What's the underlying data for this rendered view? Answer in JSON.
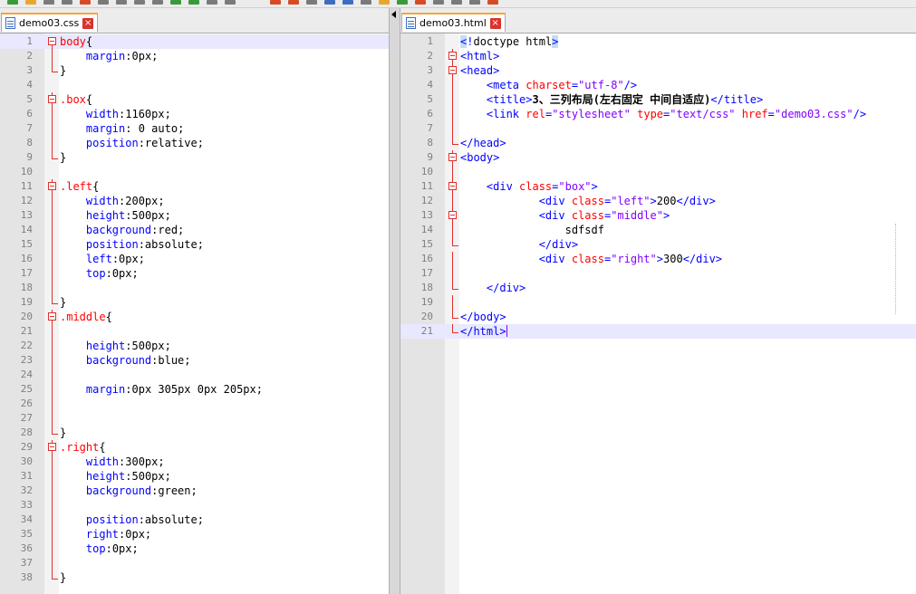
{
  "toolbar_colors": [
    "#3a9a3a",
    "#e7a72e",
    "#7a7a7a",
    "#7a7a7a",
    "#d84a24",
    "#7a7a7a",
    "#7a7a7a",
    "#7a7a7a",
    "#7a7a7a",
    "#3a9a3a",
    "#3a9a3a",
    "#7a7a7a",
    "#7a7a7a",
    "#d84a24",
    "#d84a24",
    "#7a7a7a",
    "#3d6dbf",
    "#3d6dbf",
    "#7a7a7a",
    "#e7a72e",
    "#3a9a3a",
    "#d84a24",
    "#7a7a7a",
    "#7a7a7a",
    "#7a7a7a",
    "#d84a24"
  ],
  "left": {
    "tab": {
      "label": "demo03.css",
      "icon": "file-icon",
      "close": "×"
    },
    "lines": [
      {
        "n": "1",
        "fold": "open",
        "cur": true,
        "t": [
          [
            "sel",
            "body"
          ],
          [
            "brace",
            "{"
          ]
        ]
      },
      {
        "n": "2",
        "fold": "mid",
        "t": [
          [
            "val",
            "    "
          ],
          [
            "prop",
            "margin"
          ],
          [
            "val",
            ":0px;"
          ]
        ]
      },
      {
        "n": "3",
        "fold": "end",
        "t": [
          [
            "brace",
            "}"
          ]
        ]
      },
      {
        "n": "4",
        "t": []
      },
      {
        "n": "5",
        "fold": "open",
        "t": [
          [
            "sel",
            ".box"
          ],
          [
            "brace",
            "{"
          ]
        ]
      },
      {
        "n": "6",
        "fold": "mid",
        "t": [
          [
            "val",
            "    "
          ],
          [
            "prop",
            "width"
          ],
          [
            "val",
            ":1160px;"
          ]
        ]
      },
      {
        "n": "7",
        "fold": "mid",
        "t": [
          [
            "val",
            "    "
          ],
          [
            "prop",
            "margin"
          ],
          [
            "val",
            ": 0 auto;"
          ]
        ]
      },
      {
        "n": "8",
        "fold": "mid",
        "t": [
          [
            "val",
            "    "
          ],
          [
            "prop",
            "position"
          ],
          [
            "val",
            ":relative;"
          ]
        ]
      },
      {
        "n": "9",
        "fold": "end",
        "t": [
          [
            "brace",
            "}"
          ]
        ]
      },
      {
        "n": "10",
        "t": []
      },
      {
        "n": "11",
        "fold": "open",
        "t": [
          [
            "sel",
            ".left"
          ],
          [
            "brace",
            "{"
          ]
        ]
      },
      {
        "n": "12",
        "fold": "mid",
        "t": [
          [
            "val",
            "    "
          ],
          [
            "prop",
            "width"
          ],
          [
            "val",
            ":200px;"
          ]
        ]
      },
      {
        "n": "13",
        "fold": "mid",
        "t": [
          [
            "val",
            "    "
          ],
          [
            "prop",
            "height"
          ],
          [
            "val",
            ":500px;"
          ]
        ]
      },
      {
        "n": "14",
        "fold": "mid",
        "t": [
          [
            "val",
            "    "
          ],
          [
            "prop",
            "background"
          ],
          [
            "val",
            ":red;"
          ]
        ]
      },
      {
        "n": "15",
        "fold": "mid",
        "t": [
          [
            "val",
            "    "
          ],
          [
            "prop",
            "position"
          ],
          [
            "val",
            ":absolute;"
          ]
        ]
      },
      {
        "n": "16",
        "fold": "mid",
        "t": [
          [
            "val",
            "    "
          ],
          [
            "prop",
            "left"
          ],
          [
            "val",
            ":0px;"
          ]
        ]
      },
      {
        "n": "17",
        "fold": "mid",
        "t": [
          [
            "val",
            "    "
          ],
          [
            "prop",
            "top"
          ],
          [
            "val",
            ":0px;"
          ]
        ]
      },
      {
        "n": "18",
        "fold": "mid",
        "t": []
      },
      {
        "n": "19",
        "fold": "end",
        "t": [
          [
            "brace",
            "}"
          ]
        ]
      },
      {
        "n": "20",
        "fold": "open",
        "t": [
          [
            "sel",
            ".middle"
          ],
          [
            "brace",
            "{"
          ]
        ]
      },
      {
        "n": "21",
        "fold": "mid",
        "t": []
      },
      {
        "n": "22",
        "fold": "mid",
        "t": [
          [
            "val",
            "    "
          ],
          [
            "prop",
            "height"
          ],
          [
            "val",
            ":500px;"
          ]
        ]
      },
      {
        "n": "23",
        "fold": "mid",
        "t": [
          [
            "val",
            "    "
          ],
          [
            "prop",
            "background"
          ],
          [
            "val",
            ":blue;"
          ]
        ]
      },
      {
        "n": "24",
        "fold": "mid",
        "t": []
      },
      {
        "n": "25",
        "fold": "mid",
        "t": [
          [
            "val",
            "    "
          ],
          [
            "prop",
            "margin"
          ],
          [
            "val",
            ":0px 305px 0px 205px;"
          ]
        ]
      },
      {
        "n": "26",
        "fold": "mid",
        "t": []
      },
      {
        "n": "27",
        "fold": "mid",
        "t": []
      },
      {
        "n": "28",
        "fold": "end",
        "t": [
          [
            "brace",
            "}"
          ]
        ]
      },
      {
        "n": "29",
        "fold": "open",
        "t": [
          [
            "sel",
            ".right"
          ],
          [
            "brace",
            "{"
          ]
        ]
      },
      {
        "n": "30",
        "fold": "mid",
        "t": [
          [
            "val",
            "    "
          ],
          [
            "prop",
            "width"
          ],
          [
            "val",
            ":300px;"
          ]
        ]
      },
      {
        "n": "31",
        "fold": "mid",
        "t": [
          [
            "val",
            "    "
          ],
          [
            "prop",
            "height"
          ],
          [
            "val",
            ":500px;"
          ]
        ]
      },
      {
        "n": "32",
        "fold": "mid",
        "t": [
          [
            "val",
            "    "
          ],
          [
            "prop",
            "background"
          ],
          [
            "val",
            ":green;"
          ]
        ]
      },
      {
        "n": "33",
        "fold": "mid",
        "t": []
      },
      {
        "n": "34",
        "fold": "mid",
        "t": [
          [
            "val",
            "    "
          ],
          [
            "prop",
            "position"
          ],
          [
            "val",
            ":absolute;"
          ]
        ]
      },
      {
        "n": "35",
        "fold": "mid",
        "t": [
          [
            "val",
            "    "
          ],
          [
            "prop",
            "right"
          ],
          [
            "val",
            ":0px;"
          ]
        ]
      },
      {
        "n": "36",
        "fold": "mid",
        "t": [
          [
            "val",
            "    "
          ],
          [
            "prop",
            "top"
          ],
          [
            "val",
            ":0px;"
          ]
        ]
      },
      {
        "n": "37",
        "fold": "mid",
        "t": []
      },
      {
        "n": "38",
        "fold": "end",
        "t": [
          [
            "brace",
            "}"
          ]
        ]
      }
    ]
  },
  "right": {
    "tab": {
      "label": "demo03.html",
      "icon": "file-icon",
      "close": "×"
    },
    "lines": [
      {
        "n": "1",
        "t": [
          [
            "hlb",
            "<"
          ],
          [
            "tag",
            "!"
          ],
          [
            "txt",
            "doctype html"
          ],
          [
            "hlb",
            ">"
          ]
        ]
      },
      {
        "n": "2",
        "fold": "open",
        "t": [
          [
            "tag",
            "<html>"
          ]
        ]
      },
      {
        "n": "3",
        "fold": "open",
        "t": [
          [
            "tag",
            "<head>"
          ]
        ]
      },
      {
        "n": "4",
        "fold": "mid",
        "t": [
          [
            "txt",
            "    "
          ],
          [
            "tag",
            "<meta "
          ],
          [
            "attr",
            "charset"
          ],
          [
            "tag",
            "="
          ],
          [
            "str",
            "\"utf-8\""
          ],
          [
            "tag",
            "/>"
          ]
        ]
      },
      {
        "n": "5",
        "fold": "mid",
        "t": [
          [
            "txt",
            "    "
          ],
          [
            "tag",
            "<title>"
          ],
          [
            "txt-b",
            "3、三列布局(左右固定 中间自适应)"
          ],
          [
            "tag",
            "</title>"
          ]
        ]
      },
      {
        "n": "6",
        "fold": "mid",
        "t": [
          [
            "txt",
            "    "
          ],
          [
            "tag",
            "<link "
          ],
          [
            "attr",
            "rel"
          ],
          [
            "tag",
            "="
          ],
          [
            "str",
            "\"stylesheet\""
          ],
          [
            "tag",
            " "
          ],
          [
            "attr",
            "type"
          ],
          [
            "tag",
            "="
          ],
          [
            "str",
            "\"text/css\""
          ],
          [
            "tag",
            " "
          ],
          [
            "attr",
            "href"
          ],
          [
            "tag",
            "="
          ],
          [
            "str",
            "\"demo03.css\""
          ],
          [
            "tag",
            "/>"
          ]
        ]
      },
      {
        "n": "7",
        "fold": "mid",
        "t": []
      },
      {
        "n": "8",
        "fold": "end",
        "t": [
          [
            "tag",
            "</head>"
          ]
        ]
      },
      {
        "n": "9",
        "fold": "open",
        "t": [
          [
            "tag",
            "<body>"
          ]
        ]
      },
      {
        "n": "10",
        "fold": "mid",
        "t": []
      },
      {
        "n": "11",
        "fold": "open",
        "t": [
          [
            "txt",
            "    "
          ],
          [
            "tag",
            "<div "
          ],
          [
            "attr",
            "class"
          ],
          [
            "tag",
            "="
          ],
          [
            "str",
            "\"box\""
          ],
          [
            "tag",
            ">"
          ]
        ]
      },
      {
        "n": "12",
        "fold": "mid",
        "t": [
          [
            "txt",
            "            "
          ],
          [
            "tag",
            "<div "
          ],
          [
            "attr",
            "class"
          ],
          [
            "tag",
            "="
          ],
          [
            "str",
            "\"left\""
          ],
          [
            "tag",
            ">"
          ],
          [
            "txt",
            "200"
          ],
          [
            "tag",
            "</div>"
          ]
        ]
      },
      {
        "n": "13",
        "fold": "open",
        "t": [
          [
            "txt",
            "            "
          ],
          [
            "tag",
            "<div "
          ],
          [
            "attr",
            "class"
          ],
          [
            "tag",
            "="
          ],
          [
            "str",
            "\"middle\""
          ],
          [
            "tag",
            ">"
          ]
        ]
      },
      {
        "n": "14",
        "fold": "mid",
        "t": [
          [
            "txt",
            "                sdfsdf"
          ]
        ]
      },
      {
        "n": "15",
        "fold": "end",
        "t": [
          [
            "txt",
            "            "
          ],
          [
            "tag",
            "</div>"
          ]
        ]
      },
      {
        "n": "16",
        "fold": "mid",
        "t": [
          [
            "txt",
            "            "
          ],
          [
            "tag",
            "<div "
          ],
          [
            "attr",
            "class"
          ],
          [
            "tag",
            "="
          ],
          [
            "str",
            "\"right\""
          ],
          [
            "tag",
            ">"
          ],
          [
            "txt",
            "300"
          ],
          [
            "tag",
            "</div>"
          ]
        ]
      },
      {
        "n": "17",
        "fold": "mid",
        "t": []
      },
      {
        "n": "18",
        "fold": "end",
        "t": [
          [
            "txt",
            "    "
          ],
          [
            "tag",
            "</div>"
          ]
        ]
      },
      {
        "n": "19",
        "fold": "mid",
        "t": []
      },
      {
        "n": "20",
        "fold": "end",
        "t": [
          [
            "tag",
            "</body>"
          ]
        ]
      },
      {
        "n": "21",
        "fold": "end",
        "cur": true,
        "caret": true,
        "t": [
          [
            "tag",
            "</html>"
          ]
        ]
      }
    ]
  }
}
